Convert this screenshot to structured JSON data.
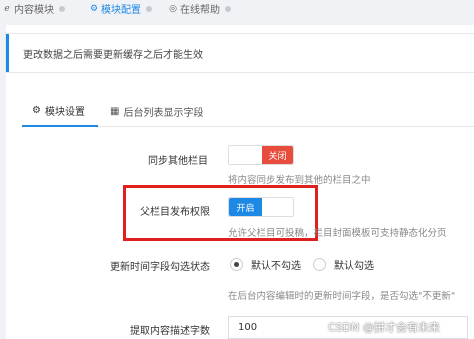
{
  "breadcrumb": {
    "items": [
      {
        "icon": "ie-icon",
        "glyph": "ℯ",
        "label": "内容模块"
      },
      {
        "icon": "gear-icon",
        "glyph": "⚙",
        "label": "模块配置"
      },
      {
        "icon": "globe-icon",
        "glyph": "◎",
        "label": "在线帮助"
      }
    ]
  },
  "notice": "更改数据之后需要更新缓存之后才能生效",
  "tabs": [
    {
      "icon": "gear-icon",
      "glyph": "⚙",
      "label": "模块设置"
    },
    {
      "icon": "table-icon",
      "glyph": "▦",
      "label": "后台列表显示字段"
    }
  ],
  "fields": {
    "sync_other": {
      "label": "同步其他栏目",
      "toggle_off_label": "关闭",
      "help": "将内容同步发布到其他的栏目之中"
    },
    "parent_publish": {
      "label": "父栏目发布权限",
      "toggle_on_label": "开启",
      "help": "允许父栏目可投稿，栏目封面模板可支持静态化分页"
    },
    "update_time": {
      "label": "更新时间字段勾选状态",
      "options": [
        "默认不勾选",
        "默认勾选"
      ],
      "selected": "默认不勾选",
      "help": "在后台内容编辑时的更新时间字段，是否勾选\"不更新\""
    },
    "desc_length": {
      "label": "提取内容描述字数",
      "value": "100"
    }
  },
  "watermark": "CSDN @拼才会有未来",
  "colors": {
    "accent": "#1e88e5",
    "danger": "#e84c3d",
    "highlight": "#e02020"
  }
}
